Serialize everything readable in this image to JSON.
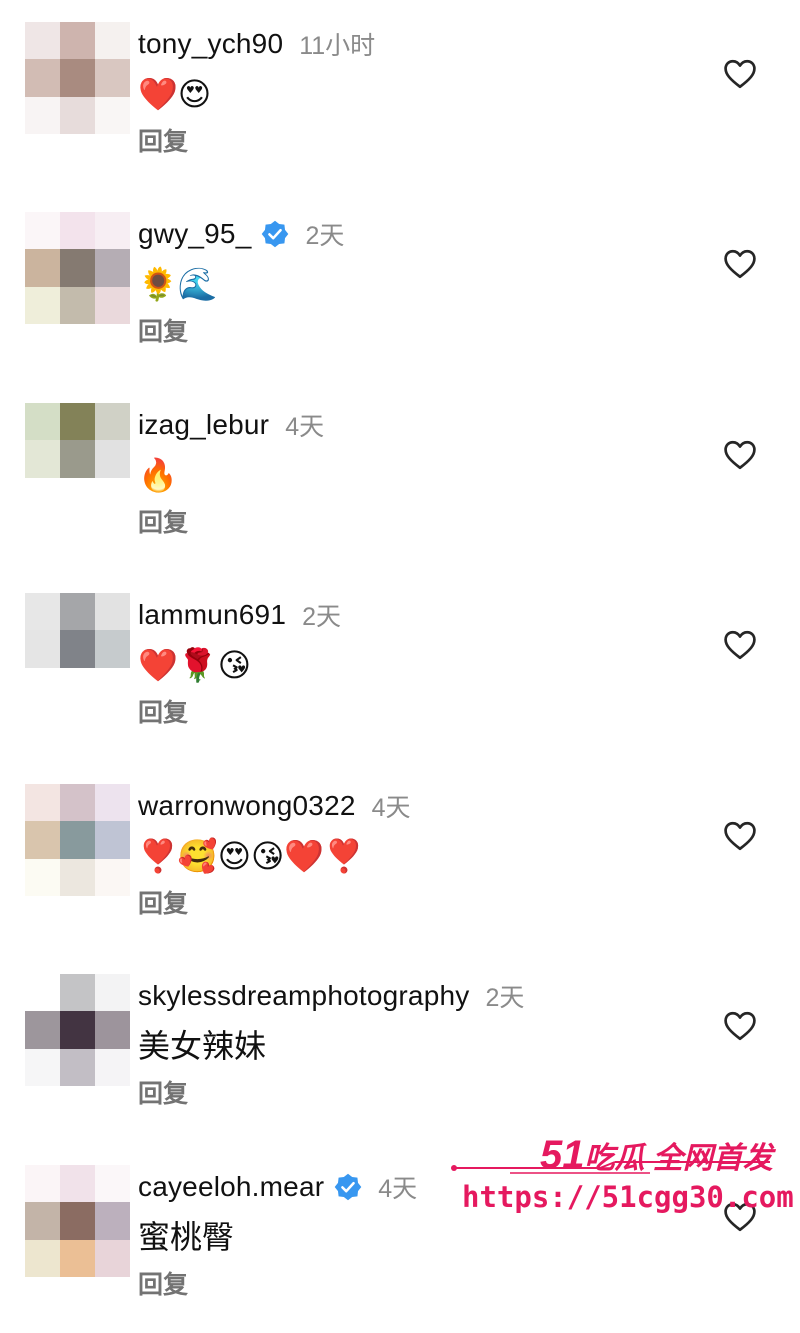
{
  "comments": [
    {
      "username": "tony_ych90",
      "verified": false,
      "time": "11小时",
      "text": "❤️😍",
      "reply": "回复",
      "avatar": [
        "#efe6e6",
        "#ceb4ae",
        "#f5f1ef",
        "#d2bcb4",
        "#a98b80",
        "#d9c7c1",
        "#f8f4f4",
        "#e7dcdb",
        "#f9f6f5"
      ]
    },
    {
      "username": "gwy_95_",
      "verified": true,
      "time": "2天",
      "text": "🌻🌊",
      "reply": "回复",
      "avatar": [
        "#fbf6f8",
        "#f3e3ec",
        "#f7eef3",
        "#cbb49e",
        "#857a71",
        "#b5adb4",
        "#efeeda",
        "#c3bbac",
        "#ead9dc"
      ]
    },
    {
      "username": "izag_lebur",
      "verified": false,
      "time": "4天",
      "text": "🔥",
      "reply": "回复",
      "avatar": [
        "#d4dec6",
        "#838258",
        "#d0d1c6",
        "#e3e7d6",
        "#9a9a8c",
        "#e1e1e1",
        "#ffffff",
        "#ffffff",
        "#ffffff"
      ]
    },
    {
      "username": "lammun691",
      "verified": false,
      "time": "2天",
      "text": "❤️🌹😘",
      "reply": "回复",
      "avatar": [
        "#e7e7e7",
        "#a5a6a9",
        "#e2e2e2",
        "#e5e5e5",
        "#808389",
        "#c6cbcd",
        "#ffffff",
        "#ffffff",
        "#ffffff"
      ]
    },
    {
      "username": "warronwong0322",
      "verified": false,
      "time": "4天",
      "text": "❣️🥰😍😘❤️❣️",
      "reply": "回复",
      "avatar": [
        "#f3e5e2",
        "#d4c2c9",
        "#ede3ee",
        "#d9c5ad",
        "#889a9d",
        "#bfc4d4",
        "#fcfbf3",
        "#ece7df",
        "#fbf7f4"
      ]
    },
    {
      "username": "skylessdreamphotography",
      "verified": false,
      "time": "2天",
      "text": "美女辣妹",
      "reply": "回复",
      "avatar": [
        "#ffffff",
        "#c4c4c6",
        "#f3f3f4",
        "#9d969c",
        "#433442",
        "#9d949c",
        "#f6f6f7",
        "#c2bec5",
        "#f5f4f6"
      ]
    },
    {
      "username": "cayeeloh.mear",
      "verified": true,
      "time": "4天",
      "text": "蜜桃臀",
      "reply": "回复",
      "avatar": [
        "#fbf5f7",
        "#f1e2ea",
        "#fbf7f9",
        "#c3b4a8",
        "#8b6c62",
        "#bcb0bd",
        "#ede6cf",
        "#ebbf95",
        "#e8d4d9"
      ]
    }
  ],
  "watermark": {
    "brand": "51",
    "brand_text": "吃瓜 全网首发",
    "url": "https://51cgg30.com",
    "color": "#e5195f"
  },
  "colors": {
    "verified_blue": "#3897f0",
    "time_gray": "#8a8a8a",
    "reply_gray": "#737373"
  },
  "icons": {
    "like": "heart-outline-icon",
    "verified": "verified-badge-icon"
  }
}
